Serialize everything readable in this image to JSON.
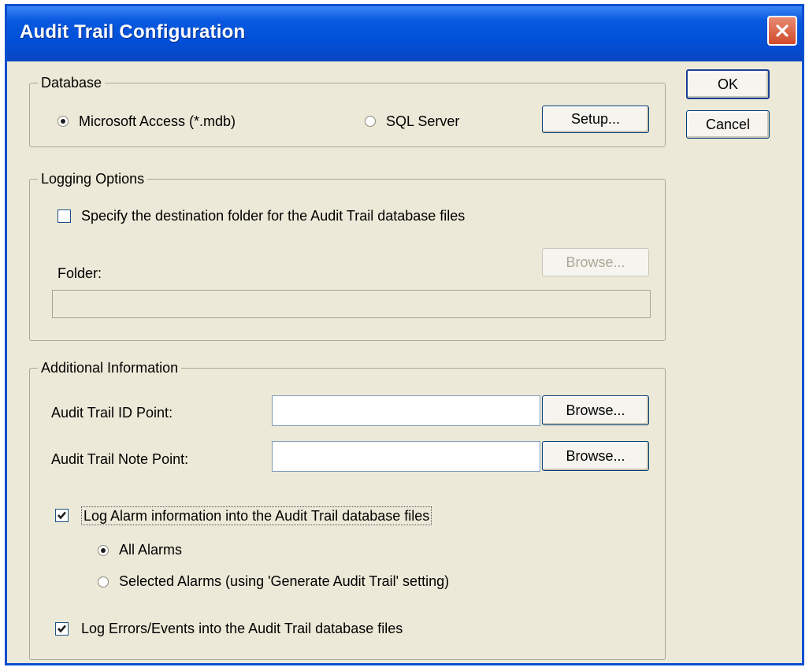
{
  "window": {
    "title": "Audit Trail Configuration"
  },
  "buttons": {
    "ok": "OK",
    "cancel": "Cancel"
  },
  "database": {
    "legend": "Database",
    "access_label": "Microsoft Access (*.mdb)",
    "sql_label": "SQL Server",
    "setup_button": "Setup...",
    "selected": "access"
  },
  "logging": {
    "legend": "Logging Options",
    "specify_folder_label": "Specify the destination folder for the Audit Trail database files",
    "specify_folder_checked": false,
    "folder_label": "Folder:",
    "browse_button": "Browse...",
    "folder_value": ""
  },
  "additional": {
    "legend": "Additional Information",
    "id_point_label": "Audit Trail ID Point:",
    "id_point_value": "",
    "note_point_label": "Audit Trail Note Point:",
    "note_point_value": "",
    "browse_button": "Browse...",
    "log_alarm_label": "Log Alarm information into the Audit Trail database files",
    "log_alarm_checked": true,
    "all_alarms_label": "All Alarms",
    "selected_alarms_label": "Selected Alarms (using 'Generate Audit Trail' setting)",
    "alarm_scope_selected": "all",
    "log_errors_label": "Log Errors/Events into the Audit Trail database files",
    "log_errors_checked": true
  },
  "colors": {
    "titlebar": "#0050d8",
    "face": "#ece9d8",
    "close": "#d04a2a"
  },
  "icons": {
    "close": "close-icon",
    "check": "checkmark-icon"
  }
}
